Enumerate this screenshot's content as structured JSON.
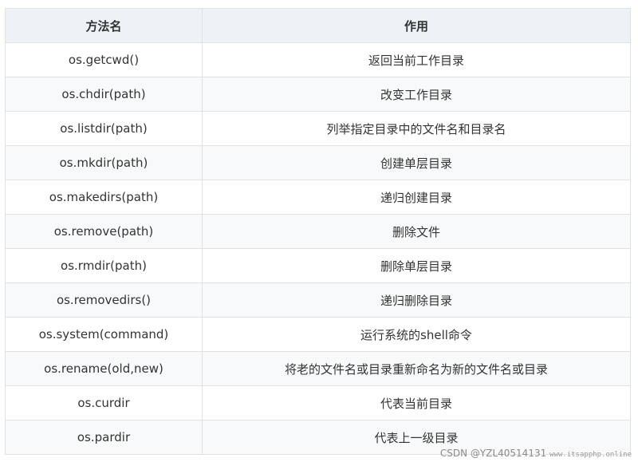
{
  "table": {
    "headers": [
      "方法名",
      "作用"
    ],
    "rows": [
      [
        "os.getcwd()",
        "返回当前工作目录"
      ],
      [
        "os.chdir(path)",
        "改变工作目录"
      ],
      [
        "os.listdir(path)",
        "列举指定目录中的文件名和目录名"
      ],
      [
        "os.mkdir(path)",
        "创建单层目录"
      ],
      [
        "os.makedirs(path)",
        "递归创建目录"
      ],
      [
        "os.remove(path)",
        "删除文件"
      ],
      [
        "os.rmdir(path)",
        "删除单层目录"
      ],
      [
        "os.removedirs()",
        "递归删除目录"
      ],
      [
        "os.system(command)",
        "运行系统的shell命令"
      ],
      [
        "os.rename(old,new)",
        "将老的文件名或目录重新命名为新的文件名或目录"
      ],
      [
        "os.curdir",
        "代表当前目录"
      ],
      [
        "os.pardir",
        "代表上一级目录"
      ]
    ]
  },
  "watermark": {
    "main": "CSDN @YZL40514131",
    "url": "www.itsapphp.online"
  }
}
